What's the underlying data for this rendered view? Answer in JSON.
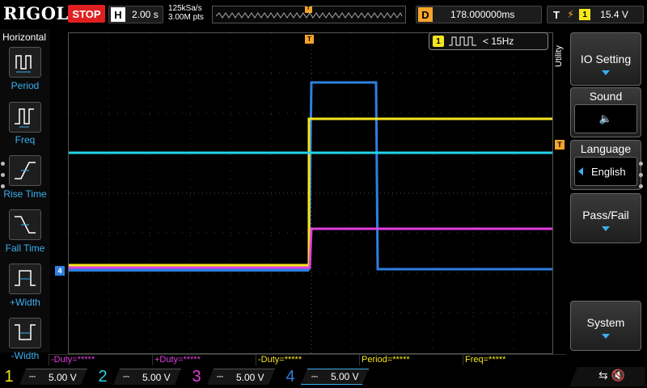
{
  "header": {
    "brand": "RIGOL",
    "run_state": "STOP",
    "horizontal_tag": "H",
    "timebase": "2.00 s",
    "sample_rate": "125kSa/s",
    "memory_depth": "3.00M pts",
    "overview_trigger_marker": "T",
    "delay_tag": "D",
    "delay": "178.000000ms",
    "trigger_tag": "T",
    "trigger_edge_symbol": "⚡",
    "trigger_source": "1",
    "trigger_level": "15.4 V"
  },
  "left_panel": {
    "title": "Horizontal",
    "items": [
      {
        "label": "Period"
      },
      {
        "label": "Freq"
      },
      {
        "label": "Rise Time"
      },
      {
        "label": "Fall Time"
      },
      {
        "label": "+Width"
      },
      {
        "label": "-Width"
      }
    ]
  },
  "grid": {
    "trigger_position_marker": "T",
    "trigger_level_marker": "T",
    "channel_ground_marker": "4",
    "freq_readout": {
      "channel": "1",
      "text": "< 15Hz"
    }
  },
  "measurements": [
    {
      "label": "-Duty=*****",
      "color": "#e040e0"
    },
    {
      "label": "+Duty=*****",
      "color": "#e040e0"
    },
    {
      "label": "-Duty=*****",
      "color": "#f5e61e"
    },
    {
      "label": "Period=*****",
      "color": "#f5e61e"
    },
    {
      "label": "Freq=*****",
      "color": "#f5e61e"
    }
  ],
  "right_menu": {
    "vertical_label": "Utility",
    "io_setting": "IO Setting",
    "sound_label": "Sound",
    "sound_icon": "🔈",
    "language_label": "Language",
    "language_value": "English",
    "pass_fail": "Pass/Fail",
    "system": "System"
  },
  "channels": [
    {
      "num": "1",
      "coupling": "⎓",
      "scale": "5.00 V",
      "color": "#f5e61e"
    },
    {
      "num": "2",
      "coupling": "⎓",
      "scale": "5.00 V",
      "color": "#22d4e8"
    },
    {
      "num": "3",
      "coupling": "⎓",
      "scale": "5.00 V",
      "color": "#e040e0"
    },
    {
      "num": "4",
      "coupling": "⎓",
      "scale": "5.00 V",
      "color": "#2f7fdf"
    }
  ],
  "system_icons": "⇆ 🔇",
  "colors": {
    "ch1": "#f5e61e",
    "ch2": "#22d4e8",
    "ch3": "#e040e0",
    "ch4": "#2f7fdf",
    "accent": "#3ab0f0",
    "trigger": "#f4a52a",
    "stop": "#e02020"
  }
}
